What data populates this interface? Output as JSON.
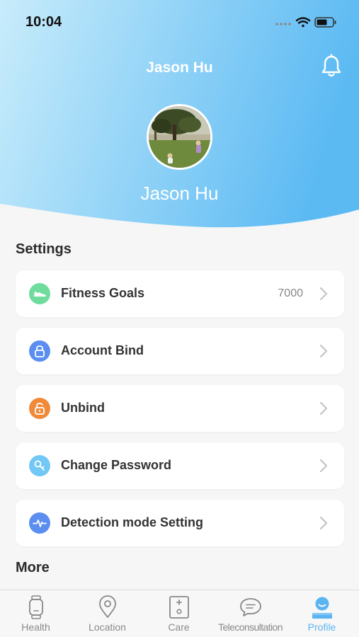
{
  "status_bar": {
    "time": "10:04"
  },
  "header": {
    "title": "Jason Hu",
    "name": "Jason Hu"
  },
  "icons": {
    "bell": "bell-icon",
    "avatar": "profile-photo"
  },
  "colors": {
    "header_gradient_start": "#c8ecfb",
    "header_gradient_end": "#5cbaf3",
    "accent": "#5ab4f0"
  },
  "settings": {
    "title": "Settings",
    "items": [
      {
        "label": "Fitness Goals",
        "value": "7000",
        "icon": "shoe-icon",
        "color": "#6fdc9e"
      },
      {
        "label": "Account Bind",
        "value": "",
        "icon": "lock-icon",
        "color": "#5b8ef0"
      },
      {
        "label": "Unbind",
        "value": "",
        "icon": "unlock-icon",
        "color": "#f08a3a"
      },
      {
        "label": "Change Password",
        "value": "",
        "icon": "key-icon",
        "color": "#72c8f5"
      },
      {
        "label": "Detection mode Setting",
        "value": "",
        "icon": "pulse-icon",
        "color": "#5b8ef0"
      }
    ]
  },
  "more": {
    "title": "More"
  },
  "tabbar": {
    "tabs": [
      {
        "label": "Health",
        "icon": "watch-icon"
      },
      {
        "label": "Location",
        "icon": "location-pin-icon"
      },
      {
        "label": "Care",
        "icon": "care-icon"
      },
      {
        "label": "Teleconsultation",
        "icon": "chat-icon"
      },
      {
        "label": "Profile",
        "icon": "profile-icon",
        "active": true
      }
    ]
  }
}
